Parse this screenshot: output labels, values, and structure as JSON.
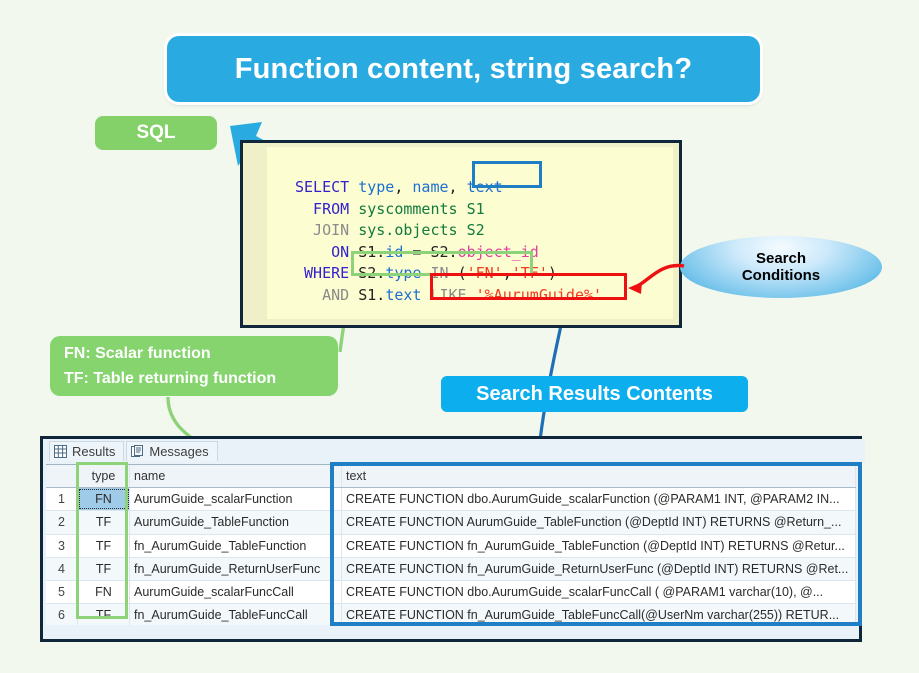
{
  "title": {
    "text": "Function content, string search?",
    "bg": "#29abe2"
  },
  "sql_tag": {
    "label": "SQL",
    "bg": "#83d168"
  },
  "sql_panel": {
    "lines": [
      [
        {
          "t": "SELECT ",
          "c": "kw"
        },
        {
          "t": "type",
          "c": "col"
        },
        {
          "t": ", ",
          "c": "plain"
        },
        {
          "t": "name",
          "c": "col"
        },
        {
          "t": ", ",
          "c": "plain"
        },
        {
          "t": "text",
          "c": "col"
        }
      ],
      [
        {
          "t": "  FROM ",
          "c": "kw"
        },
        {
          "t": "syscomments S1",
          "c": "tbl"
        }
      ],
      [
        {
          "t": "  JOIN ",
          "c": "kwg"
        },
        {
          "t": "sys.objects S2",
          "c": "tbl"
        }
      ],
      [
        {
          "t": "    ON ",
          "c": "kw"
        },
        {
          "t": "S1.",
          "c": "plain"
        },
        {
          "t": "id",
          "c": "col"
        },
        {
          "t": " = ",
          "c": "plain"
        },
        {
          "t": "S2.",
          "c": "plain"
        },
        {
          "t": "object_id",
          "c": "magenta"
        }
      ],
      [
        {
          "t": " WHERE ",
          "c": "kw"
        },
        {
          "t": "S2.",
          "c": "plain"
        },
        {
          "t": "type",
          "c": "col"
        },
        {
          "t": " IN ",
          "c": "kwg"
        },
        {
          "t": "(",
          "c": "plain"
        },
        {
          "t": "'FN'",
          "c": "str"
        },
        {
          "t": ",",
          "c": "plain"
        },
        {
          "t": "'TF'",
          "c": "str"
        },
        {
          "t": ")",
          "c": "plain"
        }
      ],
      [
        {
          "t": "   AND ",
          "c": "kwg"
        },
        {
          "t": "S1.",
          "c": "plain"
        },
        {
          "t": "text",
          "c": "col"
        },
        {
          "t": " LIKE ",
          "c": "kwg"
        },
        {
          "t": "'%AurumGuide%'",
          "c": "str"
        }
      ]
    ],
    "full_text": "SELECT type, name, text\n  FROM syscomments S1\n  JOIN sys.objects S2\n    ON S1.id = S2.object_id\n WHERE S2.type IN ('FN','TF')\n   AND S1.text LIKE '%AurumGuide%'"
  },
  "callouts": {
    "search_conditions": {
      "line1": "Search",
      "line2": "Conditions"
    },
    "legend": {
      "line1": "FN: Scalar function",
      "line2": "TF: Table returning function"
    },
    "results_banner": {
      "label": "Search Results Contents"
    }
  },
  "results": {
    "tabs": [
      {
        "label": "Results",
        "icon": "grid-icon",
        "active": true
      },
      {
        "label": "Messages",
        "icon": "messages-icon",
        "active": false
      }
    ],
    "columns": [
      "",
      "type",
      "name",
      "text"
    ],
    "rows": [
      {
        "num": "1",
        "type": "FN",
        "name": "AurumGuide_scalarFunction",
        "text": "CREATE FUNCTION dbo.AurumGuide_scalarFunction (@PARAM1 INT, @PARAM2 IN..."
      },
      {
        "num": "2",
        "type": "TF",
        "name": "AurumGuide_TableFunction",
        "text": "CREATE FUNCTION AurumGuide_TableFunction (@DeptId INT)  RETURNS @Return_..."
      },
      {
        "num": "3",
        "type": "TF",
        "name": "fn_AurumGuide_TableFunction",
        "text": "CREATE FUNCTION fn_AurumGuide_TableFunction (@DeptId INT)  RETURNS @Retur..."
      },
      {
        "num": "4",
        "type": "TF",
        "name": "fn_AurumGuide_ReturnUserFunc",
        "text": "CREATE FUNCTION fn_AurumGuide_ReturnUserFunc (@DeptId INT)  RETURNS @Ret..."
      },
      {
        "num": "5",
        "type": "FN",
        "name": "AurumGuide_scalarFuncCall",
        "text": "CREATE FUNCTION dbo.AurumGuide_scalarFuncCall (   @PARAM1 varchar(10),   @..."
      },
      {
        "num": "6",
        "type": "TF",
        "name": "fn_AurumGuide_TableFuncCall",
        "text": "CREATE FUNCTION fn_AurumGuide_TableFuncCall(@UserNm varchar(255))  RETUR..."
      }
    ]
  },
  "colors": {
    "page_bg": "#f2f8ee",
    "accent_blue": "#1f7ec4",
    "accent_green": "#8ed27a",
    "accent_red": "#ee1111",
    "banner_blue": "#0daeee",
    "code_bg": "#fdfdd2"
  }
}
